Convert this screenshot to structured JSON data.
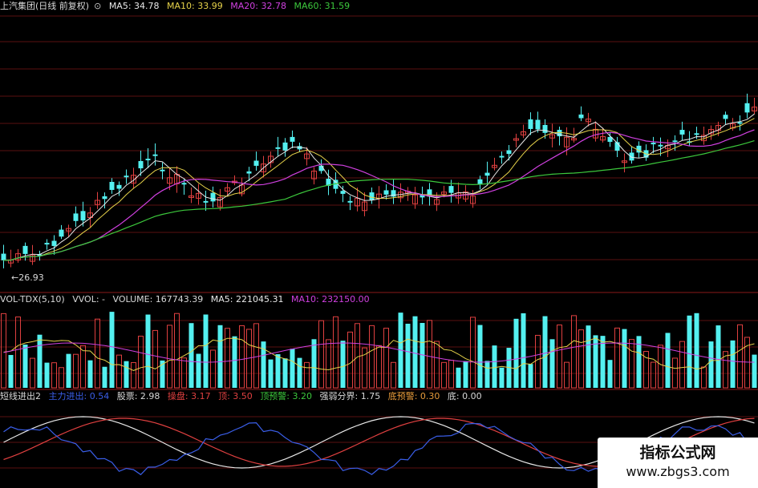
{
  "price_panel": {
    "title": "上汽集团(日线 前复权)",
    "indicators": [
      {
        "label": "MA5: 34.78",
        "color": "#e8e8e8"
      },
      {
        "label": "MA10: 33.99",
        "color": "#e6d24a"
      },
      {
        "label": "MA20: 32.78",
        "color": "#d040e0"
      },
      {
        "label": "MA60: 31.59",
        "color": "#3cc83c"
      }
    ],
    "low_marker": "←26.93"
  },
  "volume_panel": {
    "title": "VOL-TDX(5,10)",
    "indicators": [
      {
        "label": "VVOL: -",
        "color": "#d8d8d8"
      },
      {
        "label": "VOLUME: 167743.39",
        "color": "#d8d8d8"
      },
      {
        "label": "MA5: 221045.31",
        "color": "#e8e8e8"
      },
      {
        "label": "MA10: 232150.00",
        "color": "#d040e0"
      }
    ]
  },
  "indicator_panel": {
    "title": "短线进出2",
    "indicators": [
      {
        "label": "主力进出: 0.54",
        "color": "#3a5ee8"
      },
      {
        "label": "股票: 2.98",
        "color": "#d8d8d8"
      },
      {
        "label": "操盘: 3.17",
        "color": "#e04040"
      },
      {
        "label": "顶: 3.50",
        "color": "#e04040"
      },
      {
        "label": "顶预警: 3.20",
        "color": "#3cc83c"
      },
      {
        "label": "强弱分界: 1.75",
        "color": "#d8d8d8"
      },
      {
        "label": "底预警: 0.30",
        "color": "#e69a3a"
      },
      {
        "label": "底: 0.00",
        "color": "#d8d8d8"
      }
    ]
  },
  "watermark": {
    "title": "指标公式网",
    "url": "www.zbgs3.com"
  },
  "colors": {
    "up": "#e04040",
    "down": "#54f0f0",
    "grid": "#5a0f0f",
    "separator": "#8a1a1a"
  }
}
